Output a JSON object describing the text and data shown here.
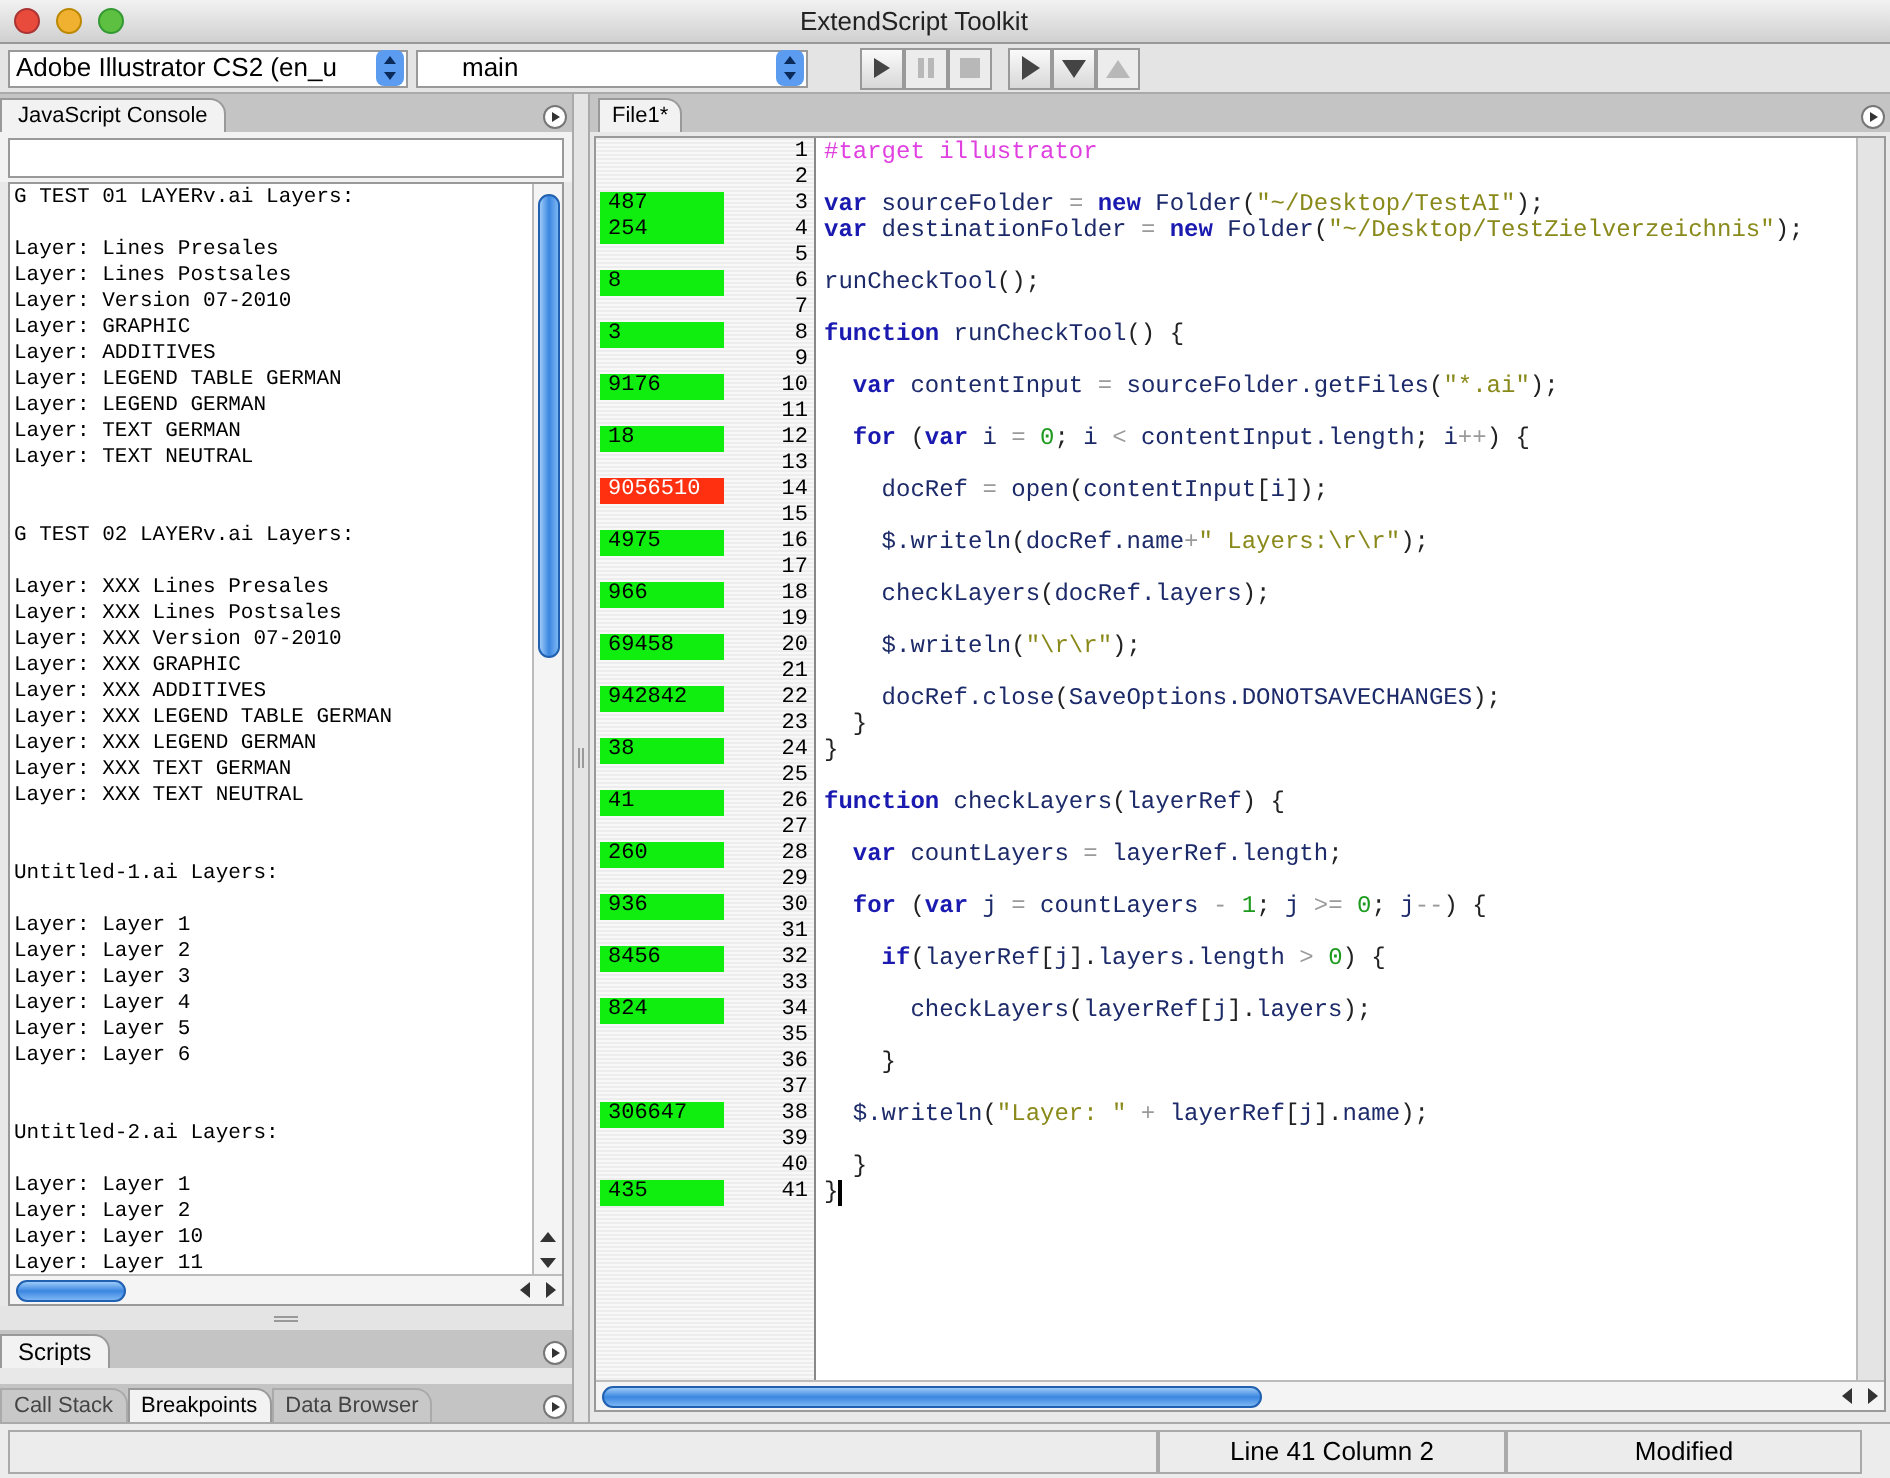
{
  "window": {
    "title": "ExtendScript Toolkit"
  },
  "toolbar": {
    "target": "Adobe Illustrator CS2 (en_u",
    "engine": "main",
    "buttons": [
      {
        "kind": "run",
        "disabled": false
      },
      {
        "kind": "pause",
        "disabled": true
      },
      {
        "kind": "stop",
        "disabled": true
      },
      {
        "kind": "step-over",
        "disabled": false
      },
      {
        "kind": "step-into",
        "disabled": false
      },
      {
        "kind": "step-out",
        "disabled": true
      }
    ]
  },
  "console": {
    "tab": {
      "label": "JavaScript Console",
      "selected": true
    },
    "blocks": [
      {
        "header": "G TEST 01 LAYERv.ai Layers:",
        "lines": [
          "Layer: Lines Presales",
          "Layer: Lines Postsales",
          "Layer: Version 07-2010",
          "Layer: GRAPHIC",
          "Layer: ADDITIVES",
          "Layer: LEGEND TABLE GERMAN",
          "Layer: LEGEND GERMAN",
          "Layer: TEXT GERMAN",
          "Layer: TEXT NEUTRAL"
        ]
      },
      {
        "header": "G TEST 02 LAYERv.ai Layers:",
        "lines": [
          "Layer: XXX Lines Presales",
          "Layer: XXX Lines Postsales",
          "Layer: XXX Version 07-2010",
          "Layer: XXX GRAPHIC",
          "Layer: XXX ADDITIVES",
          "Layer: XXX LEGEND TABLE GERMAN",
          "Layer: XXX LEGEND GERMAN",
          "Layer: XXX TEXT GERMAN",
          "Layer: XXX TEXT NEUTRAL"
        ]
      },
      {
        "header": "Untitled-1.ai Layers:",
        "lines": [
          "Layer: Layer 1",
          "Layer: Layer 2",
          "Layer: Layer 3",
          "Layer: Layer 4",
          "Layer: Layer 5",
          "Layer: Layer 6"
        ]
      },
      {
        "header": "Untitled-2.ai Layers:",
        "lines": [
          "Layer: Layer 1",
          "Layer: Layer 2",
          "Layer: Layer 10",
          "Layer: Layer 11"
        ]
      }
    ]
  },
  "scripts_tab": {
    "label": "Scripts",
    "selected": true
  },
  "bottom_tabs": [
    {
      "label": "Call Stack",
      "selected": false
    },
    {
      "label": "Breakpoints",
      "selected": true
    },
    {
      "label": "Data Browser",
      "selected": false
    }
  ],
  "editor": {
    "tab": {
      "label": "File1*",
      "selected": true
    },
    "lines": [
      {
        "number": "1",
        "caret": false,
        "tokens": [
          {
            "kind": "dir",
            "text": "#target illustrator"
          }
        ]
      },
      {
        "number": "2",
        "caret": false
      },
      {
        "number": "3",
        "caret": false,
        "profile": "487",
        "hot": false,
        "tokens": [
          {
            "kind": "kw",
            "text": "var"
          },
          {
            "kind": "id",
            "text": " sourceFolder "
          },
          {
            "kind": "op",
            "text": "="
          },
          {
            "kind": "kw",
            "text": " new"
          },
          {
            "kind": "id",
            "text": " Folder"
          },
          {
            "kind": "p",
            "text": "("
          },
          {
            "kind": "str",
            "text": "\"~/Desktop/TestAI\""
          },
          {
            "kind": "p",
            "text": ");"
          }
        ]
      },
      {
        "number": "4",
        "caret": false,
        "profile": "254",
        "hot": false,
        "tokens": [
          {
            "kind": "kw",
            "text": "var"
          },
          {
            "kind": "id",
            "text": " destinationFolder "
          },
          {
            "kind": "op",
            "text": "="
          },
          {
            "kind": "kw",
            "text": " new"
          },
          {
            "kind": "id",
            "text": " Folder"
          },
          {
            "kind": "p",
            "text": "("
          },
          {
            "kind": "str",
            "text": "\"~/Desktop/TestZielverzeichnis\""
          },
          {
            "kind": "p",
            "text": ");"
          }
        ]
      },
      {
        "number": "5",
        "caret": false
      },
      {
        "number": "6",
        "caret": false,
        "profile": "8",
        "hot": false,
        "tokens": [
          {
            "kind": "id",
            "text": "runCheckTool"
          },
          {
            "kind": "p",
            "text": "();"
          }
        ]
      },
      {
        "number": "7",
        "caret": false
      },
      {
        "number": "8",
        "caret": false,
        "profile": "3",
        "hot": false,
        "tokens": [
          {
            "kind": "kw",
            "text": "function"
          },
          {
            "kind": "id",
            "text": " runCheckTool"
          },
          {
            "kind": "p",
            "text": "() {"
          }
        ]
      },
      {
        "number": "9",
        "caret": false
      },
      {
        "number": "10",
        "caret": false,
        "profile": "9176",
        "hot": false,
        "tokens": [
          {
            "kind": "kw",
            "text": "  var"
          },
          {
            "kind": "id",
            "text": " contentInput "
          },
          {
            "kind": "op",
            "text": "="
          },
          {
            "kind": "id",
            "text": " sourceFolder.getFiles"
          },
          {
            "kind": "p",
            "text": "("
          },
          {
            "kind": "str",
            "text": "\"*.ai\""
          },
          {
            "kind": "p",
            "text": ");"
          }
        ]
      },
      {
        "number": "11",
        "caret": false
      },
      {
        "number": "12",
        "caret": false,
        "profile": "18",
        "hot": false,
        "tokens": [
          {
            "kind": "kw",
            "text": "  for"
          },
          {
            "kind": "p",
            "text": " ("
          },
          {
            "kind": "kw",
            "text": "var"
          },
          {
            "kind": "id",
            "text": " i "
          },
          {
            "kind": "op",
            "text": "="
          },
          {
            "kind": "num",
            "text": " 0"
          },
          {
            "kind": "p",
            "text": "; "
          },
          {
            "kind": "id",
            "text": "i "
          },
          {
            "kind": "op",
            "text": "<"
          },
          {
            "kind": "id",
            "text": " contentInput.length"
          },
          {
            "kind": "p",
            "text": "; "
          },
          {
            "kind": "id",
            "text": "i"
          },
          {
            "kind": "op",
            "text": "++"
          },
          {
            "kind": "p",
            "text": ") {"
          }
        ]
      },
      {
        "number": "13",
        "caret": false
      },
      {
        "number": "14",
        "caret": false,
        "profile": "9056510",
        "hot": true,
        "tokens": [
          {
            "kind": "id",
            "text": "    docRef "
          },
          {
            "kind": "op",
            "text": "="
          },
          {
            "kind": "id",
            "text": " open"
          },
          {
            "kind": "p",
            "text": "("
          },
          {
            "kind": "id",
            "text": "contentInput"
          },
          {
            "kind": "p",
            "text": "["
          },
          {
            "kind": "id",
            "text": "i"
          },
          {
            "kind": "p",
            "text": "]);"
          }
        ]
      },
      {
        "number": "15",
        "caret": false
      },
      {
        "number": "16",
        "caret": false,
        "profile": "4975",
        "hot": false,
        "tokens": [
          {
            "kind": "id",
            "text": "    $.writeln"
          },
          {
            "kind": "p",
            "text": "("
          },
          {
            "kind": "id",
            "text": "docRef.name"
          },
          {
            "kind": "op",
            "text": "+"
          },
          {
            "kind": "str",
            "text": "\" Layers:\\r\\r\""
          },
          {
            "kind": "p",
            "text": ");"
          }
        ]
      },
      {
        "number": "17",
        "caret": false
      },
      {
        "number": "18",
        "caret": false,
        "profile": "966",
        "hot": false,
        "tokens": [
          {
            "kind": "id",
            "text": "    checkLayers"
          },
          {
            "kind": "p",
            "text": "("
          },
          {
            "kind": "id",
            "text": "docRef.layers"
          },
          {
            "kind": "p",
            "text": ");"
          }
        ]
      },
      {
        "number": "19",
        "caret": false
      },
      {
        "number": "20",
        "caret": false,
        "profile": "69458",
        "hot": false,
        "tokens": [
          {
            "kind": "id",
            "text": "    $.writeln"
          },
          {
            "kind": "p",
            "text": "("
          },
          {
            "kind": "str",
            "text": "\"\\r\\r\""
          },
          {
            "kind": "p",
            "text": ");"
          }
        ]
      },
      {
        "number": "21",
        "caret": false
      },
      {
        "number": "22",
        "caret": false,
        "profile": "942842",
        "hot": false,
        "tokens": [
          {
            "kind": "id",
            "text": "    docRef.close"
          },
          {
            "kind": "p",
            "text": "("
          },
          {
            "kind": "id",
            "text": "SaveOptions.DONOTSAVECHANGES"
          },
          {
            "kind": "p",
            "text": ");"
          }
        ]
      },
      {
        "number": "23",
        "caret": false,
        "tokens": [
          {
            "kind": "p",
            "text": "  }"
          }
        ]
      },
      {
        "number": "24",
        "caret": false,
        "profile": "38",
        "hot": false,
        "tokens": [
          {
            "kind": "p",
            "text": "}"
          }
        ]
      },
      {
        "number": "25",
        "caret": false
      },
      {
        "number": "26",
        "caret": false,
        "profile": "41",
        "hot": false,
        "tokens": [
          {
            "kind": "kw",
            "text": "function"
          },
          {
            "kind": "id",
            "text": " checkLayers"
          },
          {
            "kind": "p",
            "text": "("
          },
          {
            "kind": "id",
            "text": "layerRef"
          },
          {
            "kind": "p",
            "text": ") {"
          }
        ]
      },
      {
        "number": "27",
        "caret": false
      },
      {
        "number": "28",
        "caret": false,
        "profile": "260",
        "hot": false,
        "tokens": [
          {
            "kind": "kw",
            "text": "  var"
          },
          {
            "kind": "id",
            "text": " countLayers "
          },
          {
            "kind": "op",
            "text": "="
          },
          {
            "kind": "id",
            "text": " layerRef.length"
          },
          {
            "kind": "p",
            "text": ";"
          }
        ]
      },
      {
        "number": "29",
        "caret": false
      },
      {
        "number": "30",
        "caret": false,
        "profile": "936",
        "hot": false,
        "tokens": [
          {
            "kind": "kw",
            "text": "  for"
          },
          {
            "kind": "p",
            "text": " ("
          },
          {
            "kind": "kw",
            "text": "var"
          },
          {
            "kind": "id",
            "text": " j "
          },
          {
            "kind": "op",
            "text": "="
          },
          {
            "kind": "id",
            "text": " countLayers "
          },
          {
            "kind": "op",
            "text": "-"
          },
          {
            "kind": "num",
            "text": " 1"
          },
          {
            "kind": "p",
            "text": "; "
          },
          {
            "kind": "id",
            "text": "j "
          },
          {
            "kind": "op",
            "text": ">="
          },
          {
            "kind": "num",
            "text": " 0"
          },
          {
            "kind": "p",
            "text": "; "
          },
          {
            "kind": "id",
            "text": "j"
          },
          {
            "kind": "op",
            "text": "--"
          },
          {
            "kind": "p",
            "text": ") {"
          }
        ]
      },
      {
        "number": "31",
        "caret": false
      },
      {
        "number": "32",
        "caret": false,
        "profile": "8456",
        "hot": false,
        "tokens": [
          {
            "kind": "kw",
            "text": "    if"
          },
          {
            "kind": "p",
            "text": "("
          },
          {
            "kind": "id",
            "text": "layerRef"
          },
          {
            "kind": "p",
            "text": "["
          },
          {
            "kind": "id",
            "text": "j"
          },
          {
            "kind": "p",
            "text": "]."
          },
          {
            "kind": "id",
            "text": "layers.length "
          },
          {
            "kind": "op",
            "text": ">"
          },
          {
            "kind": "num",
            "text": " 0"
          },
          {
            "kind": "p",
            "text": ") {"
          }
        ]
      },
      {
        "number": "33",
        "caret": false
      },
      {
        "number": "34",
        "caret": false,
        "profile": "824",
        "hot": false,
        "tokens": [
          {
            "kind": "id",
            "text": "      checkLayers"
          },
          {
            "kind": "p",
            "text": "("
          },
          {
            "kind": "id",
            "text": "layerRef"
          },
          {
            "kind": "p",
            "text": "["
          },
          {
            "kind": "id",
            "text": "j"
          },
          {
            "kind": "p",
            "text": "]."
          },
          {
            "kind": "id",
            "text": "layers"
          },
          {
            "kind": "p",
            "text": ");"
          }
        ]
      },
      {
        "number": "35",
        "caret": false
      },
      {
        "number": "36",
        "caret": false,
        "tokens": [
          {
            "kind": "p",
            "text": "    }"
          }
        ]
      },
      {
        "number": "37",
        "caret": false
      },
      {
        "number": "38",
        "caret": false,
        "profile": "306647",
        "hot": false,
        "tokens": [
          {
            "kind": "id",
            "text": "  $.writeln"
          },
          {
            "kind": "p",
            "text": "("
          },
          {
            "kind": "str",
            "text": "\"Layer: \""
          },
          {
            "kind": "op",
            "text": " +"
          },
          {
            "kind": "id",
            "text": " layerRef"
          },
          {
            "kind": "p",
            "text": "["
          },
          {
            "kind": "id",
            "text": "j"
          },
          {
            "kind": "p",
            "text": "]."
          },
          {
            "kind": "id",
            "text": "name"
          },
          {
            "kind": "p",
            "text": ");"
          }
        ]
      },
      {
        "number": "39",
        "caret": false
      },
      {
        "number": "40",
        "caret": false,
        "tokens": [
          {
            "kind": "p",
            "text": "  }"
          }
        ]
      },
      {
        "number": "41",
        "caret": true,
        "profile": "435",
        "hot": false,
        "tokens": [
          {
            "kind": "p",
            "text": "}"
          }
        ]
      }
    ]
  },
  "status_bar": {
    "position": "Line 41 Column 2",
    "state": "Modified"
  }
}
